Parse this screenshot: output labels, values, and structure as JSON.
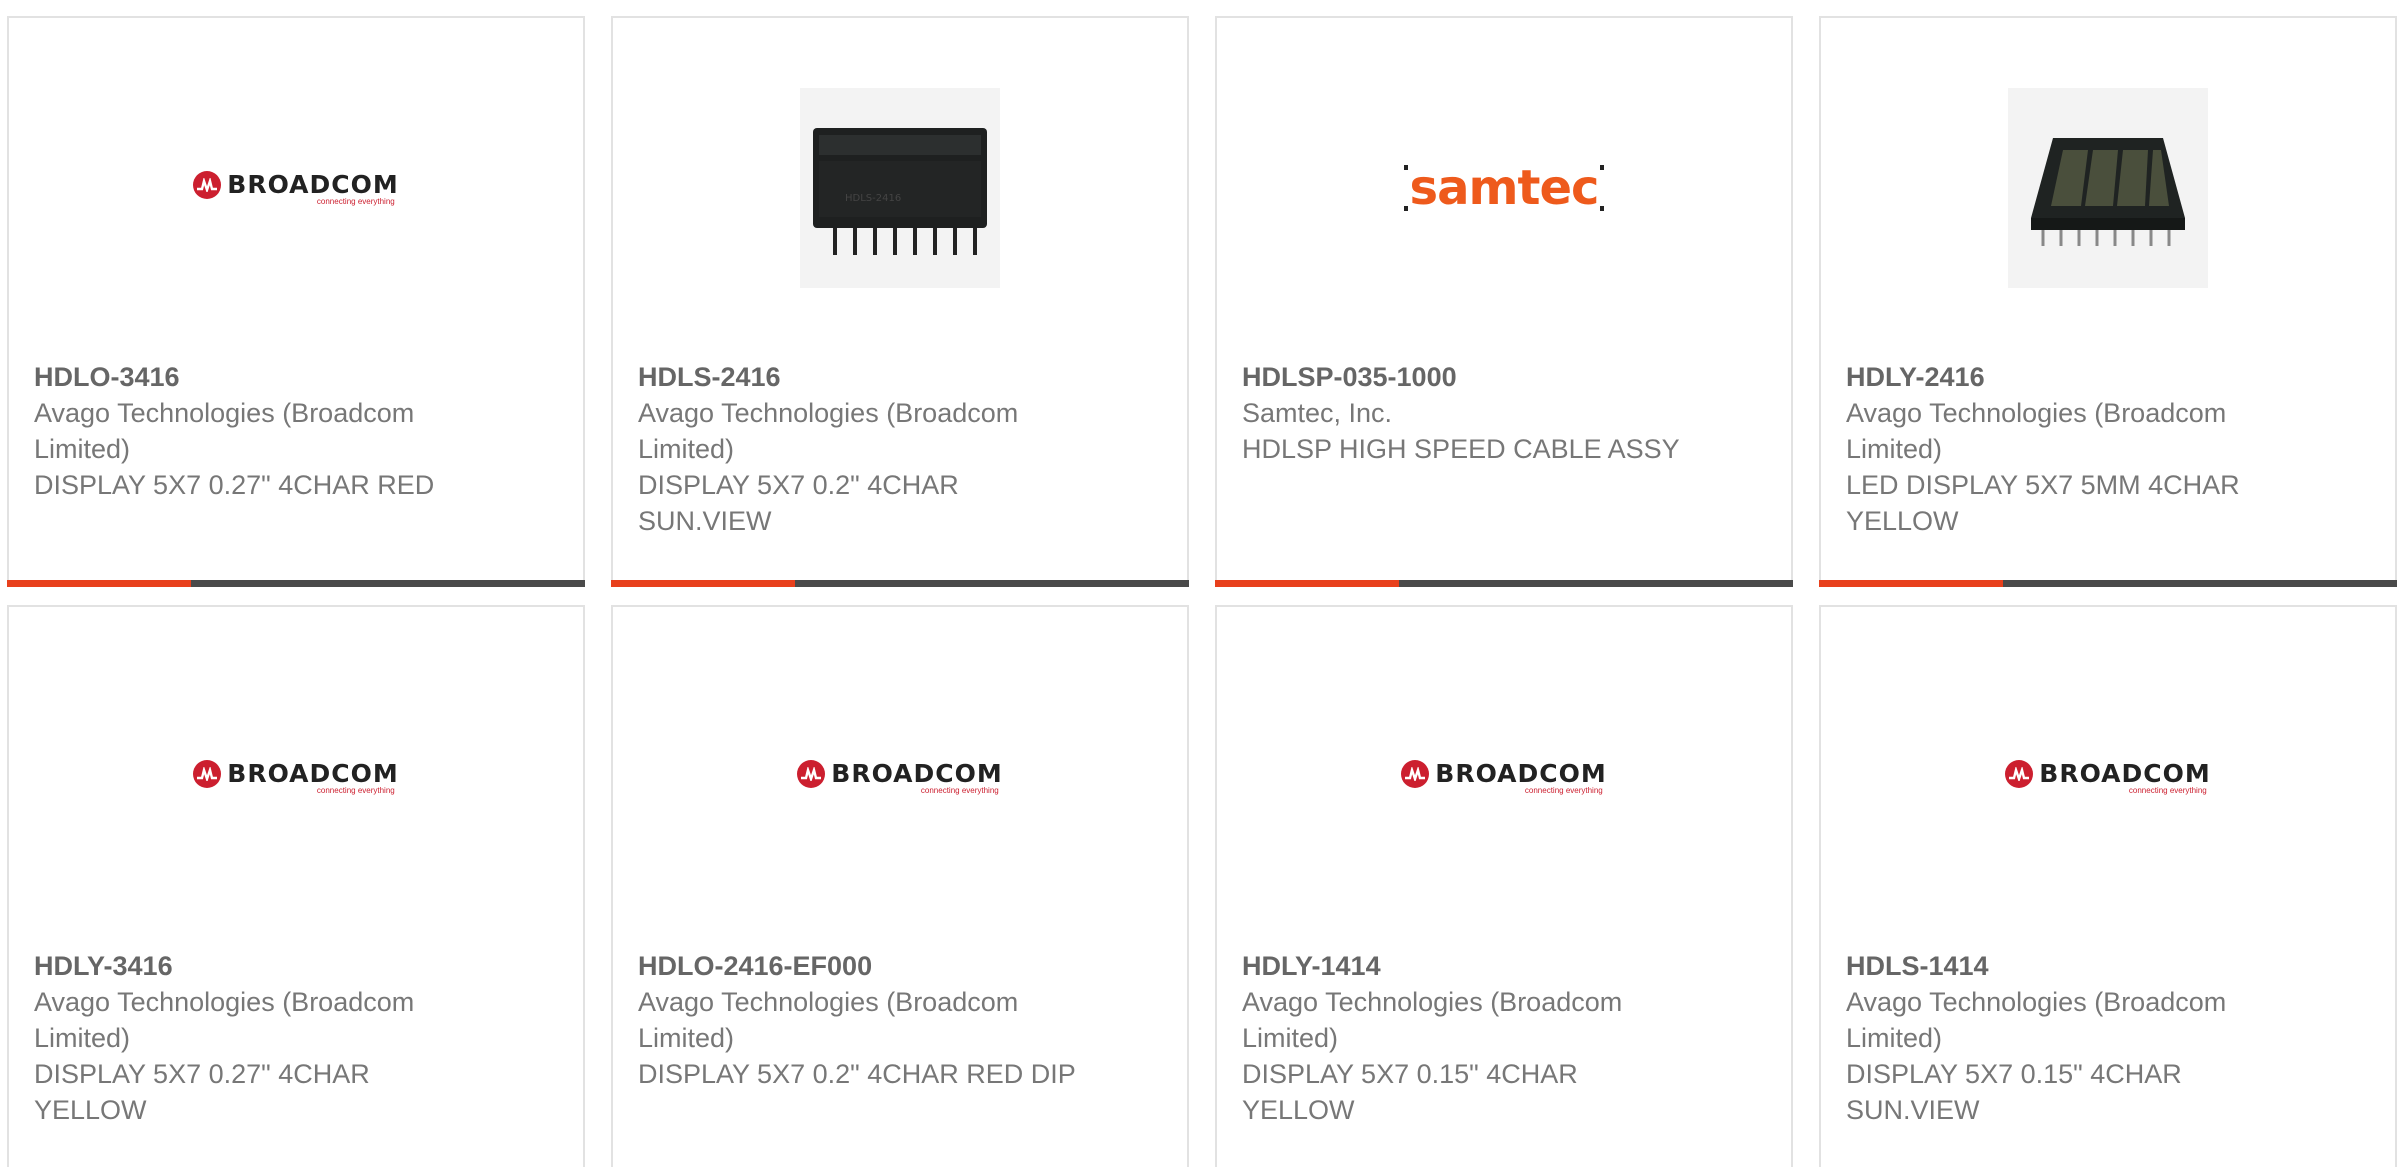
{
  "products": [
    {
      "part": "HDLO-3416",
      "manufacturer": "Avago Technologies (Broadcom Limited)",
      "description": "DISPLAY 5X7 0.27\" 4CHAR RED",
      "image": "broadcom-logo",
      "brand_name": "BROADCOM",
      "brand_tagline": "connecting everything"
    },
    {
      "part": "HDLS-2416",
      "manufacturer": "Avago Technologies (Broadcom Limited)",
      "description": "DISPLAY 5X7 0.2\" 4CHAR SUN.VIEW",
      "image": "display-module-photo"
    },
    {
      "part": "HDLSP-035-1000",
      "manufacturer": "Samtec, Inc.",
      "description": "HDLSP HIGH SPEED CABLE ASSY",
      "image": "samtec-logo",
      "brand_name": "samtec"
    },
    {
      "part": "HDLY-2416",
      "manufacturer": "Avago Technologies (Broadcom Limited)",
      "description": "LED DISPLAY 5X7 5MM 4CHAR YELLOW",
      "image": "dip-display-photo"
    },
    {
      "part": "HDLY-3416",
      "manufacturer": "Avago Technologies (Broadcom Limited)",
      "description": "DISPLAY 5X7 0.27\" 4CHAR YELLOW",
      "image": "broadcom-logo",
      "brand_name": "BROADCOM",
      "brand_tagline": "connecting everything"
    },
    {
      "part": "HDLO-2416-EF000",
      "manufacturer": "Avago Technologies (Broadcom Limited)",
      "description": "DISPLAY 5X7 0.2\" 4CHAR RED DIP",
      "image": "broadcom-logo",
      "brand_name": "BROADCOM",
      "brand_tagline": "connecting everything"
    },
    {
      "part": "HDLY-1414",
      "manufacturer": "Avago Technologies (Broadcom Limited)",
      "description": "DISPLAY 5X7 0.15\" 4CHAR YELLOW",
      "image": "broadcom-logo",
      "brand_name": "BROADCOM",
      "brand_tagline": "connecting everything"
    },
    {
      "part": "HDLS-1414",
      "manufacturer": "Avago Technologies (Broadcom Limited)",
      "description": "DISPLAY 5X7 0.15\" 4CHAR SUN.VIEW",
      "image": "broadcom-logo",
      "brand_name": "BROADCOM",
      "brand_tagline": "connecting everything"
    }
  ],
  "colors": {
    "accent": "#e8401c",
    "bar": "#4a4a4a",
    "text": "#777777",
    "part_number": "#666666",
    "broadcom_red": "#cc1f2f",
    "samtec_orange": "#ee5a1c"
  }
}
